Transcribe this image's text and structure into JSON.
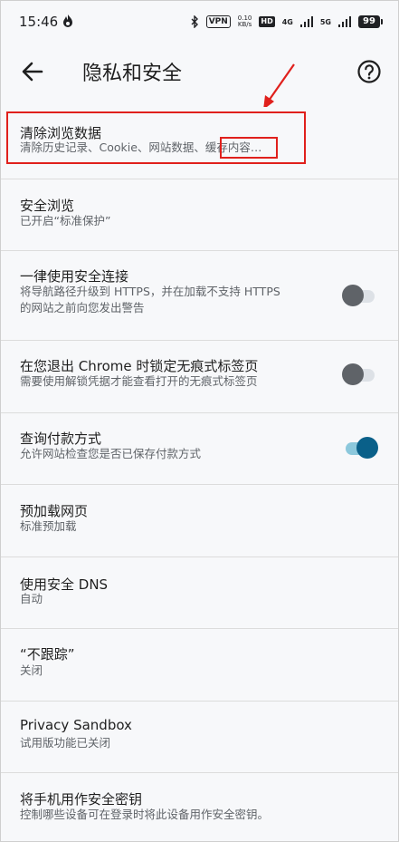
{
  "status_bar": {
    "time": "15:46",
    "vpn": "VPN",
    "speed_top": "0.10",
    "speed_bottom": "KB/s",
    "hd": "HD",
    "net1": "4G",
    "net2": "5G",
    "battery": "99"
  },
  "app_bar": {
    "title": "隐私和安全",
    "back_icon": "arrow-back-icon",
    "help_icon": "help-circle-icon"
  },
  "settings": [
    {
      "title": "清除浏览数据",
      "subtitle": "清除历史记录、Cookie、网站数据、缓存内容…"
    },
    {
      "title": "安全浏览",
      "subtitle": "已开启“标准保护”"
    },
    {
      "title": "一律使用安全连接",
      "subtitle_line1": "将导航路径升级到 HTTPS，并在加载不支持 HTTPS",
      "subtitle_line2": "的网站之前向您发出警告",
      "toggle": false
    },
    {
      "title": "在您退出 Chrome 时锁定无痕式标签页",
      "subtitle": "需要使用解锁凭据才能查看打开的无痕式标签页",
      "toggle": false
    },
    {
      "title": "查询付款方式",
      "subtitle": "允许网站检查您是否已保存付款方式",
      "toggle": true
    },
    {
      "title": "预加载网页",
      "subtitle": "标准预加载"
    },
    {
      "title": "使用安全 DNS",
      "subtitle": "自动"
    },
    {
      "title": "“不跟踪”",
      "subtitle": "关闭"
    },
    {
      "title": "Privacy Sandbox",
      "subtitle": "试用版功能已关闭"
    },
    {
      "title": "将手机用作安全密钥",
      "subtitle": "控制哪些设备可在登录时将此设备用作安全密钥。"
    }
  ],
  "colors": {
    "annotation_red": "#e0201c",
    "toggle_on": "#0a6089",
    "toggle_off": "#5f6368"
  }
}
